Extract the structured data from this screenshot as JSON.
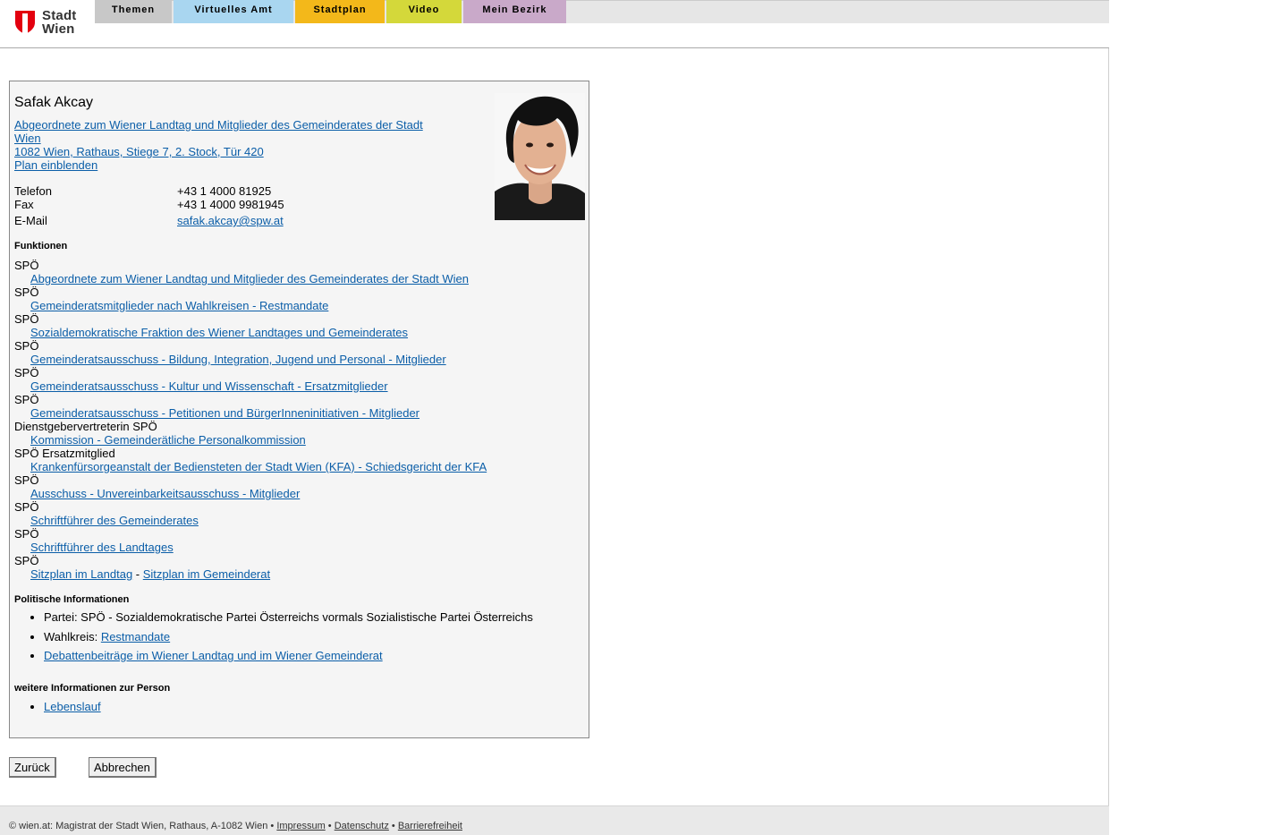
{
  "logo": {
    "line1": "Stadt",
    "line2": "Wien"
  },
  "nav": [
    {
      "label": "Themen",
      "color": "#c8c8c8",
      "width": 86
    },
    {
      "label": "Virtuelles Amt",
      "color": "#a9d6f0",
      "width": 134
    },
    {
      "label": "Stadtplan",
      "color": "#f3b81a",
      "width": 100
    },
    {
      "label": "Video",
      "color": "#d4d83a",
      "width": 84
    },
    {
      "label": "Mein Bezirk",
      "color": "#c9a9c9",
      "width": 115
    }
  ],
  "person": {
    "name": "Safak Akcay",
    "role_line1": "Abgeordnete zum Wiener Landtag und Mitglieder des Gemeinderates der Stadt",
    "role_line2": "Wien ",
    "address": "1082 Wien, Rathaus, Stiege 7, 2. Stock, Tür 420",
    "plan_link": "Plan einblenden",
    "contact": [
      {
        "label": "Telefon",
        "value": "+43 1 4000 81925"
      },
      {
        "label": "Fax",
        "value": "+43 1 4000 9981945"
      },
      {
        "label": "E-Mail",
        "value": "safak.akcay@spw.at",
        "link": true
      }
    ]
  },
  "functions_heading": "Funktionen",
  "functions": [
    {
      "party": "SPÖ",
      "link": "Abgeordnete zum Wiener Landtag und Mitglieder des Gemeinderates der Stadt Wien"
    },
    {
      "party": "SPÖ",
      "link": "Gemeinderatsmitglieder nach Wahlkreisen - Restmandate"
    },
    {
      "party": "SPÖ",
      "link": "Sozialdemokratische Fraktion des Wiener Landtages und Gemeinderates"
    },
    {
      "party": "SPÖ",
      "link": "Gemeinderatsausschuss - Bildung, Integration, Jugend und Personal - Mitglieder"
    },
    {
      "party": "SPÖ",
      "link": "Gemeinderatsausschuss - Kultur und Wissenschaft - Ersatzmitglieder"
    },
    {
      "party": "SPÖ",
      "link": "Gemeinderatsausschuss - Petitionen und BürgerInneninitiativen - Mitglieder"
    },
    {
      "party": "Dienstgebervertreterin SPÖ",
      "link": "Kommission - Gemeinderätliche Personalkommission"
    },
    {
      "party": "SPÖ Ersatzmitglied",
      "link": "Krankenfürsorgeanstalt der Bediensteten der Stadt Wien (KFA) - Schiedsgericht der KFA"
    },
    {
      "party": "SPÖ",
      "link": "Ausschuss - Unvereinbarkeitsausschuss - Mitglieder"
    },
    {
      "party": "SPÖ",
      "link": "Schriftführer des Gemeinderates"
    },
    {
      "party": "SPÖ",
      "link": "Schriftführer des Landtages"
    }
  ],
  "seating": {
    "party": "SPÖ",
    "link1": "Sitzplan im Landtag",
    "sep": " - ",
    "link2": "Sitzplan im Gemeinderat"
  },
  "political_heading": "Politische Informationen",
  "political": {
    "partei": "Partei: SPÖ - Sozialdemokratische Partei Österreichs vormals Sozialistische Partei Österreichs",
    "wahlkreis_label": "Wahlkreis: ",
    "wahlkreis_link": "Restmandate",
    "debatten": "Debattenbeiträge im Wiener Landtag und im Wiener Gemeinderat"
  },
  "more_heading": "weitere Informationen zur Person",
  "more": {
    "lebenslauf": "Lebenslauf"
  },
  "buttons": {
    "back": "Zurück",
    "cancel": "Abbrechen"
  },
  "footer": {
    "text": "© wien.at: Magistrat der Stadt Wien, Rathaus, A-1082 Wien",
    "bullet": " • ",
    "impressum": "Impressum",
    "datenschutz": "Datenschutz",
    "barrierefreiheit": "Barrierefreiheit"
  }
}
